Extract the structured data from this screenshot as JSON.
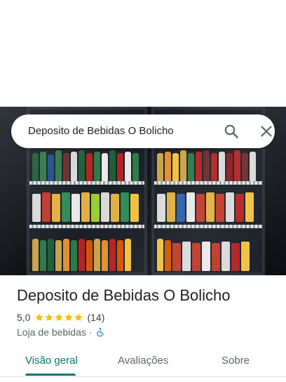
{
  "search": {
    "query": "Deposito de Bebidas O Bolicho",
    "search_icon": "search-icon",
    "clear_icon": "close-icon"
  },
  "place": {
    "name": "Deposito de Bebidas O Bolicho",
    "rating": "5,0",
    "stars": 5,
    "review_count": "(14)",
    "category": "Loja de bebidas",
    "separator": "·",
    "accessibility_icon": "wheelchair-icon",
    "star_color": "#fbbc04"
  },
  "tabs": [
    {
      "label": "Visão geral",
      "active": true
    },
    {
      "label": "Avaliações",
      "active": false
    },
    {
      "label": "Sobre",
      "active": false
    }
  ],
  "colors": {
    "accent": "#00796b",
    "accessibility": "#1a73e8"
  }
}
